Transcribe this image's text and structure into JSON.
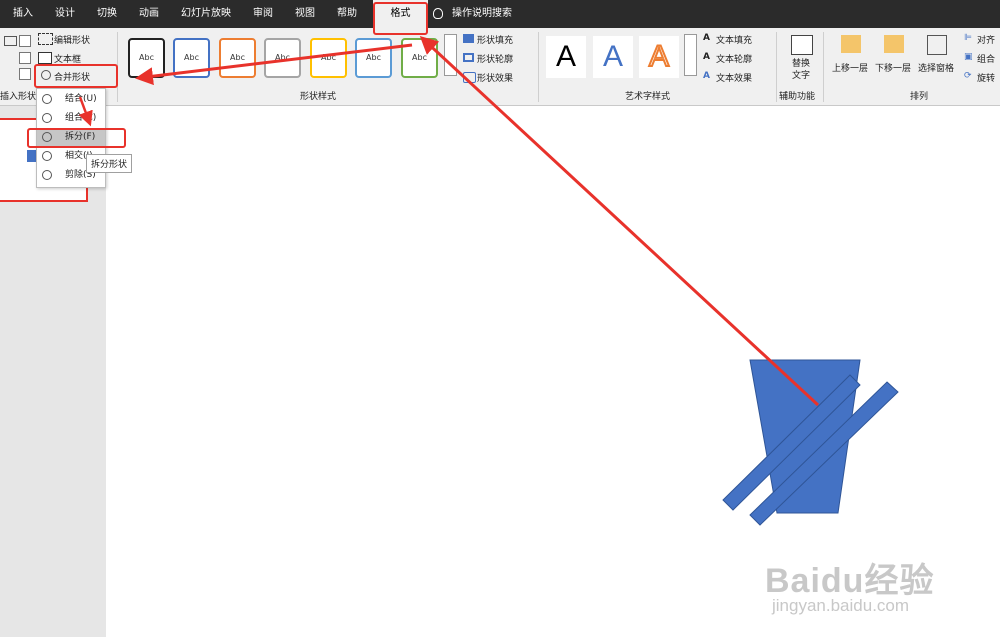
{
  "tabs": [
    "插入",
    "设计",
    "切换",
    "动画",
    "幻灯片放映",
    "审阅",
    "视图",
    "帮助",
    "格式",
    "操作说明搜索"
  ],
  "active_tab": "格式",
  "insert_shapes": {
    "edit_shape": "编辑形状",
    "text_box": "文本框",
    "merge_shapes": "合并形状",
    "group_label": "插入形状"
  },
  "shape_styles": {
    "samples": [
      "Abc",
      "Abc",
      "Abc",
      "Abc",
      "Abc",
      "Abc",
      "Abc"
    ],
    "fill": "形状填充",
    "outline": "形状轮廓",
    "effects": "形状效果",
    "group_label": "形状样式"
  },
  "wordart": {
    "samples": [
      "A",
      "A",
      "A"
    ],
    "fill": "文本填充",
    "outline": "文本轮廓",
    "effects": "文本效果",
    "group_label": "艺术字样式"
  },
  "accessibility": {
    "alt_text": "替换文字",
    "group_label": "辅助功能"
  },
  "arrange": {
    "bring_forward": "上移一层",
    "send_backward": "下移一层",
    "selection_pane": "选择窗格",
    "align": "对齐",
    "group": "组合",
    "rotate": "旋转",
    "group_label": "排列"
  },
  "merge_menu": [
    {
      "label": "结合",
      "key": "(U)"
    },
    {
      "label": "组合",
      "key": "(C)"
    },
    {
      "label": "拆分",
      "key": "(F)"
    },
    {
      "label": "相交",
      "key": "(I)"
    },
    {
      "label": "剪除",
      "key": "(S)"
    }
  ],
  "tooltip": "拆分形状",
  "watermark": {
    "brand": "Baidu经验",
    "url": "jingyan.baidu.com"
  },
  "colors": {
    "shape_fill": "#4472c4",
    "annotation": "#e8322b",
    "tabbar": "#2b2b2b"
  }
}
